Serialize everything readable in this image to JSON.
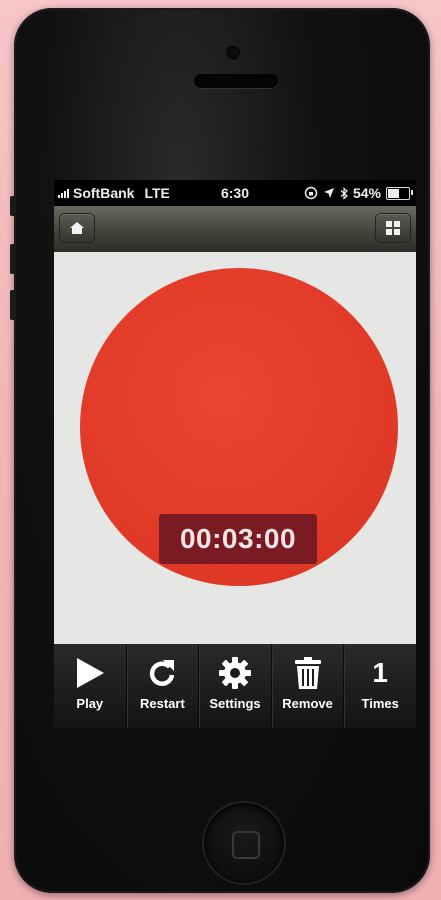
{
  "status_bar": {
    "carrier": "SoftBank",
    "network": "LTE",
    "time": "6:30",
    "battery": "54%",
    "battery_level": 0.54
  },
  "navbar": {
    "home_icon": "home-icon",
    "grid_icon": "grid-icon"
  },
  "timer": {
    "display": "00:03:00",
    "circle_color": "#e23a28",
    "display_bg": "#7a1a22"
  },
  "toolbar": {
    "play_label": "Play",
    "restart_label": "Restart",
    "settings_label": "Settings",
    "remove_label": "Remove",
    "times_count": "1",
    "times_label": "Times"
  }
}
